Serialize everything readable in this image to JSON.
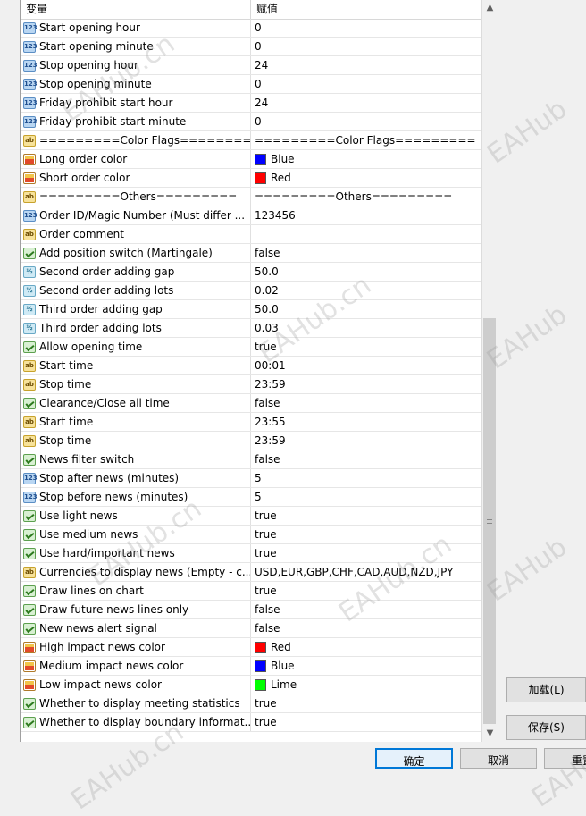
{
  "header": {
    "col_variable": "变量",
    "col_value": "赋值"
  },
  "rows": [
    {
      "type": "int",
      "name": "Start opening hour",
      "value": "0"
    },
    {
      "type": "int",
      "name": "Start opening minute",
      "value": "0"
    },
    {
      "type": "int",
      "name": "Stop opening hour",
      "value": "24"
    },
    {
      "type": "int",
      "name": "Stop opening minute",
      "value": "0"
    },
    {
      "type": "int",
      "name": "Friday prohibit start hour",
      "value": "24"
    },
    {
      "type": "int",
      "name": "Friday prohibit start minute",
      "value": "0"
    },
    {
      "type": "str",
      "name": "=========Color Flags=========",
      "value": "=========Color Flags========="
    },
    {
      "type": "clr",
      "name": "Long order color",
      "value": "Blue",
      "swatch": "#0000ff"
    },
    {
      "type": "clr",
      "name": "Short order color",
      "value": "Red",
      "swatch": "#ff0000"
    },
    {
      "type": "str",
      "name": "=========Others=========",
      "value": "=========Others========="
    },
    {
      "type": "int",
      "name": "Order ID/Magic Number (Must differ ...",
      "value": "123456"
    },
    {
      "type": "str",
      "name": "Order comment",
      "value": ""
    },
    {
      "type": "bool",
      "name": "Add position switch (Martingale)",
      "value": "false"
    },
    {
      "type": "dbl",
      "name": "Second order adding gap",
      "value": "50.0"
    },
    {
      "type": "dbl",
      "name": "Second order adding lots",
      "value": "0.02"
    },
    {
      "type": "dbl",
      "name": "Third order adding gap",
      "value": "50.0"
    },
    {
      "type": "dbl",
      "name": "Third order adding lots",
      "value": "0.03"
    },
    {
      "type": "bool",
      "name": "Allow opening time",
      "value": "true"
    },
    {
      "type": "str",
      "name": "Start time",
      "value": "00:01"
    },
    {
      "type": "str",
      "name": "Stop time",
      "value": "23:59"
    },
    {
      "type": "bool",
      "name": "Clearance/Close all time",
      "value": "false"
    },
    {
      "type": "str",
      "name": "Start time",
      "value": "23:55"
    },
    {
      "type": "str",
      "name": "Stop time",
      "value": "23:59"
    },
    {
      "type": "bool",
      "name": "News filter switch",
      "value": "false"
    },
    {
      "type": "int",
      "name": "Stop after news (minutes)",
      "value": "5"
    },
    {
      "type": "int",
      "name": "Stop before news (minutes)",
      "value": "5"
    },
    {
      "type": "bool",
      "name": "Use light news",
      "value": "true"
    },
    {
      "type": "bool",
      "name": "Use medium news",
      "value": "true"
    },
    {
      "type": "bool",
      "name": "Use hard/important news",
      "value": "true"
    },
    {
      "type": "str",
      "name": "Currencies to display news (Empty - c...",
      "value": "USD,EUR,GBP,CHF,CAD,AUD,NZD,JPY"
    },
    {
      "type": "bool",
      "name": "Draw lines on chart",
      "value": "true"
    },
    {
      "type": "bool",
      "name": "Draw future news lines only",
      "value": "false"
    },
    {
      "type": "bool",
      "name": "New news alert signal",
      "value": "false"
    },
    {
      "type": "clr",
      "name": "High impact news color",
      "value": "Red",
      "swatch": "#ff0000"
    },
    {
      "type": "clr",
      "name": "Medium impact news color",
      "value": "Blue",
      "swatch": "#0000ff"
    },
    {
      "type": "clr",
      "name": "Low impact news color",
      "value": "Lime",
      "swatch": "#00ff00"
    },
    {
      "type": "bool",
      "name": "Whether to display meeting statistics",
      "value": "true"
    },
    {
      "type": "bool",
      "name": "Whether to display boundary informat...",
      "value": "true"
    }
  ],
  "icons": {
    "int": "123",
    "dbl": "½",
    "str": "ab",
    "bool": "",
    "clr": ""
  },
  "buttons": {
    "load": "加载(L)",
    "save": "保存(S)",
    "ok": "确定",
    "cancel": "取消",
    "reset": "重置"
  },
  "watermarks": [
    "EAHub.cn",
    "EAHub",
    "EAHub.cn",
    "EAHub",
    "EAHub.cn",
    "EAHub",
    "EAHub.cn",
    "EAHub.cn",
    "EAHub"
  ]
}
